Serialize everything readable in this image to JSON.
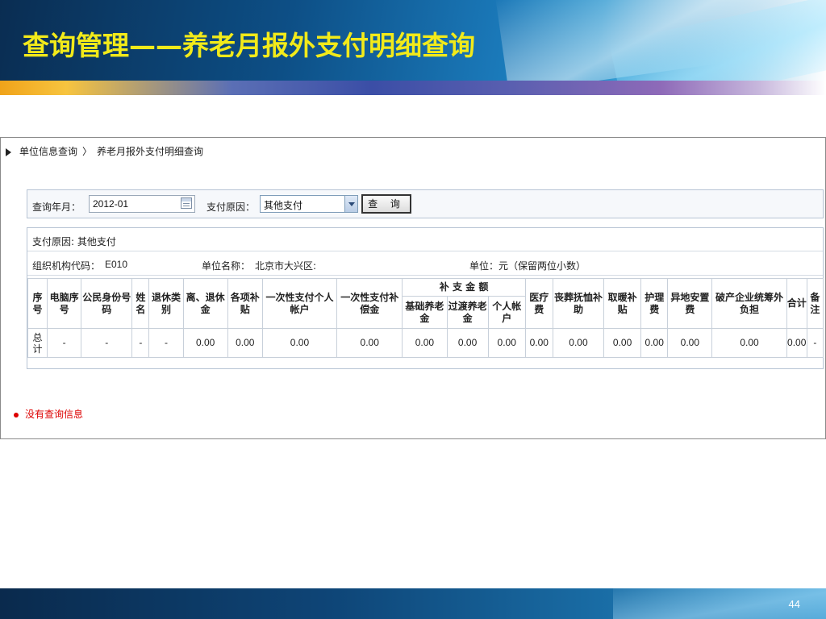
{
  "slide": {
    "title": "查询管理——养老月报外支付明细查询",
    "page_number": "44"
  },
  "breadcrumb": {
    "root": "单位信息查询",
    "separator": "〉",
    "current": "养老月报外支付明细查询"
  },
  "query": {
    "month_label": "查询年月：",
    "month_value": "2012-01",
    "reason_label": "支付原因：",
    "reason_value": "其他支付",
    "search_button": "查 询"
  },
  "result": {
    "reason_line": "支付原因: 其他支付",
    "org_code_label": "组织机构代码：",
    "org_code_value": "E010",
    "unit_name_label": "单位名称：",
    "unit_name_value": "北京市大兴区:",
    "unit_note": "单位：元（保留两位小数）"
  },
  "table": {
    "headers": {
      "seq": "序号",
      "computer_seq": "电脑序号",
      "id_number": "公民身份号码",
      "name": "姓名",
      "retire_type": "退休类别",
      "pension": "离、退休金",
      "subsidies": "各项补贴",
      "lump_personal": "一次性支付个人帐户",
      "lump_compensation": "一次性支付补偿金",
      "supplement_group": "补 支 金 额",
      "basic_pension": "基础养老金",
      "transition_pension": "过渡养老金",
      "personal_account": "个人帐户",
      "medical": "医疗费",
      "funeral": "丧葬抚恤补助",
      "heating": "取暖补贴",
      "nursing": "护理费",
      "relocation": "异地安置费",
      "bankruptcy": "破产企业统筹外负担",
      "total": "合计",
      "remark": "备注"
    },
    "rows": [
      {
        "seq": "总计",
        "computer_seq": "-",
        "id_number": "-",
        "name": "-",
        "retire_type": "-",
        "pension": "0.00",
        "subsidies": "0.00",
        "lump_personal": "0.00",
        "lump_compensation": "0.00",
        "basic_pension": "0.00",
        "transition_pension": "0.00",
        "personal_account": "0.00",
        "medical": "0.00",
        "funeral": "0.00",
        "heating": "0.00",
        "nursing": "0.00",
        "relocation": "0.00",
        "bankruptcy": "0.00",
        "total": "0.00",
        "remark": "-"
      }
    ]
  },
  "empty_message": "没有查询信息",
  "colors": {
    "title": "#f2ea1a",
    "error": "#dd0000",
    "border": "#c8d0da"
  }
}
